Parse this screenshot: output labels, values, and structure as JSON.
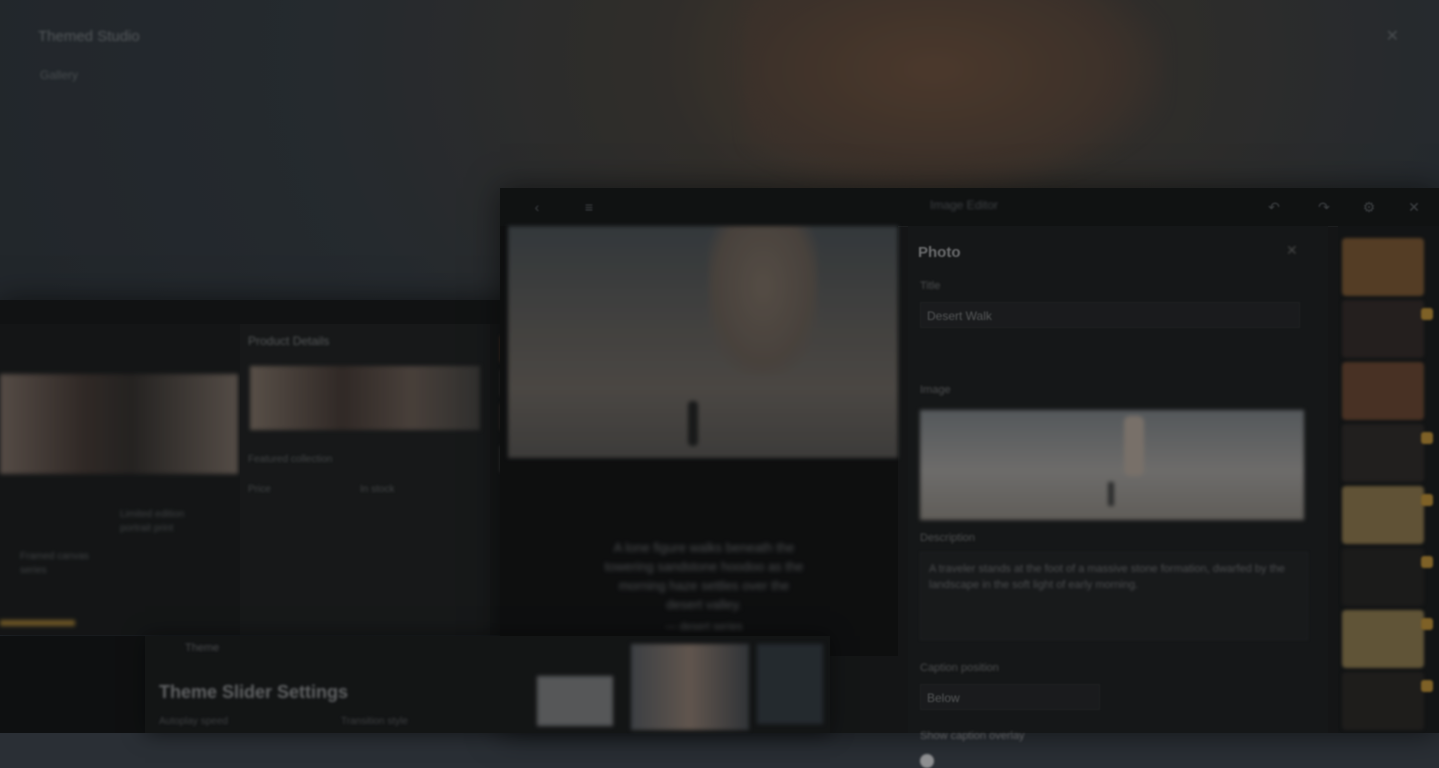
{
  "background": {
    "title": "Themed Studio",
    "subtitle": "Gallery",
    "close_icon": "close-icon"
  },
  "main_window": {
    "toolbar_title": "Image Editor",
    "preview_caption": "A lone figure walks beneath the towering sandstone hoodoo as the morning haze settles over the desert valley.",
    "preview_signature": "— desert series",
    "form": {
      "title": "Photo",
      "title_field_label": "Title",
      "title_field_value": "Desert Walk",
      "image_label": "Image",
      "description_label": "Description",
      "description_value": "A traveler stands at the foot of a massive stone formation, dwarfed by the landscape in the soft light of early morning.",
      "layout_label": "Caption position",
      "layout_value": "Below",
      "overlay_label": "Show caption overlay"
    },
    "strip_colors": [
      "#6a4a2a",
      "#2a2220",
      "#5a3a28",
      "#262220",
      "#7a6640",
      "#1e1c1b",
      "#7a6842",
      "#221f1d"
    ],
    "accent": "#a27a2c"
  },
  "left_window": {
    "panel_title": "Product Details",
    "field_a": "Featured collection",
    "field_b": "Price",
    "field_c": "In stock",
    "desc_a": "Limited edition portrait print",
    "desc_b": "Framed canvas series"
  },
  "bottom_window": {
    "tab_label": "Theme",
    "title": "Theme Slider Settings",
    "col_a": "Autoplay speed",
    "col_b": "Transition style"
  }
}
